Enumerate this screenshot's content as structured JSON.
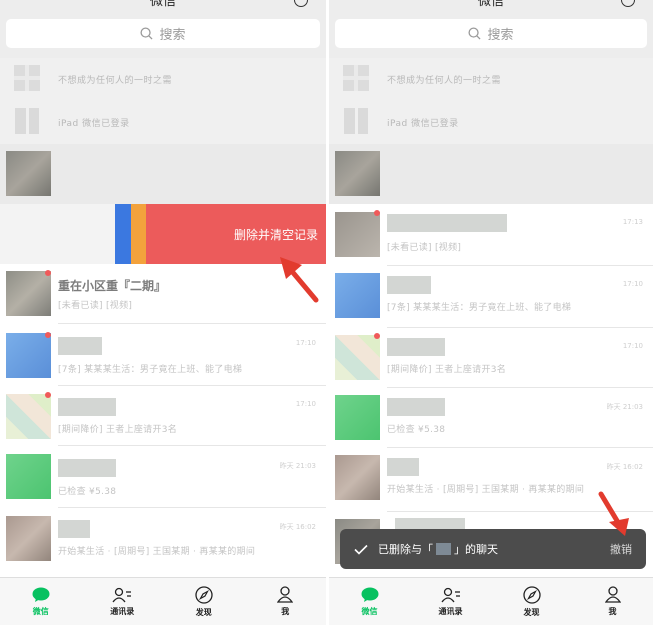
{
  "title": "微信",
  "search": {
    "placeholder": "搜索"
  },
  "left": {
    "mini_rows": [
      {
        "text": "不想成为任何人的一时之需"
      },
      {
        "text": "iPad 微信已登录"
      }
    ],
    "swipe_action": {
      "label": "删除并清空记录"
    },
    "chats": [
      {
        "name": "重在小区重『二期』",
        "preview": "[未看已读] [视频]"
      },
      {
        "preview": "[7条] 某某某生活：男子竟在上班、能了电梯",
        "time": "17:10"
      },
      {
        "preview": "[期间降价] 王者上座请开3名",
        "time": "17:10"
      },
      {
        "preview": "已检查 ¥5.38",
        "time": "昨天 21:03"
      },
      {
        "preview": "开始某生活 · [周期号] 王国某期 · 再某某的期间",
        "time": "昨天 16:02"
      }
    ]
  },
  "right": {
    "mini_rows": [
      {
        "text": "不想成为任何人的一时之需"
      },
      {
        "text": "iPad 微信已登录"
      }
    ],
    "chats": [
      {
        "preview": "[未看已读] [视频]",
        "time": "17:13"
      },
      {
        "preview": "[7条] 某某某生活：男子竟在上班、能了电梯",
        "time": "17:10"
      },
      {
        "preview": "[期间降价] 王者上座请开3名",
        "time": "17:10"
      },
      {
        "preview": "已检查 ¥5.38",
        "time": "昨天 21:03"
      },
      {
        "preview": "开始某生活 · [周期号] 王国某期 · 再某某的期间",
        "time": "昨天 16:02"
      }
    ],
    "toast": {
      "prefix": "已删除与「",
      "suffix": "」的聊天",
      "undo": "撤销"
    }
  },
  "tabs": [
    {
      "label": "微信",
      "icon": "chat-bubble-icon",
      "active": true
    },
    {
      "label": "通讯录",
      "icon": "contacts-icon"
    },
    {
      "label": "发现",
      "icon": "compass-icon"
    },
    {
      "label": "我",
      "icon": "person-icon"
    }
  ],
  "colors": {
    "accent": "#07c160",
    "delete": "#ec5b5b",
    "arrow": "#e23b2e",
    "toast": "#4c4c4c"
  }
}
